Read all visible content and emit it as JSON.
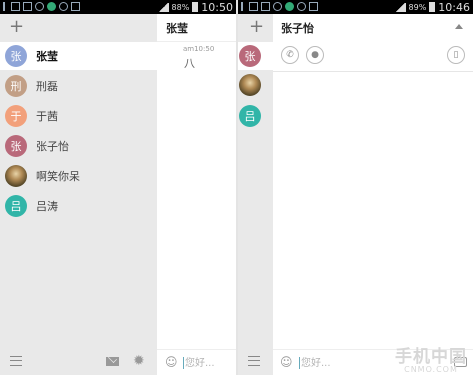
{
  "colors": {
    "accent_blue": "#8fa5d8",
    "red_avatar": "#b9697a",
    "orange_avatar": "#f2a07b",
    "brown_avatar": "#c29f86",
    "teal_avatar": "#31b5a8"
  },
  "left_screen": {
    "status": {
      "battery": "88%",
      "time": "10:50"
    },
    "contacts": [
      {
        "initial": "张",
        "name": "张莹",
        "color": "#8fa5d8",
        "photo": false
      },
      {
        "initial": "刑",
        "name": "刑磊",
        "color": "#c29f86",
        "photo": false
      },
      {
        "initial": "于",
        "name": "于茜",
        "color": "#f2a07b",
        "photo": false
      },
      {
        "initial": "张",
        "name": "张子怡",
        "color": "#b9697a",
        "photo": false
      },
      {
        "initial": "",
        "name": "啊笑你呆",
        "color": "#4a4a2a",
        "photo": true
      },
      {
        "initial": "吕",
        "name": "吕涛",
        "color": "#31b5a8",
        "photo": false
      }
    ],
    "chat": {
      "title": "张莹",
      "messages": [
        {
          "time": "am10:50",
          "text": "八"
        }
      ],
      "input_placeholder": "您好..."
    },
    "icons": {
      "add": "plus-icon",
      "menu": "menu-icon",
      "mail": "mail-icon",
      "settings": "gear-icon",
      "emoji": "smile-icon"
    }
  },
  "right_screen": {
    "status": {
      "battery": "89%",
      "time": "10:46"
    },
    "contact_avatars": [
      {
        "initial": "张",
        "color": "#b9697a",
        "photo": false
      },
      {
        "initial": "",
        "color": "#4a4a2a",
        "photo": true
      },
      {
        "initial": "吕",
        "color": "#31b5a8",
        "photo": false
      }
    ],
    "detail": {
      "name": "张子怡",
      "input_placeholder": "您好..."
    },
    "icons": {
      "call": "phone-icon",
      "profile": "person-icon",
      "delete": "trash-icon",
      "collapse": "triangle-up-icon",
      "camera": "camera-icon"
    }
  },
  "watermark": {
    "line1": "手机中国",
    "line2": "CNMO.COM"
  }
}
